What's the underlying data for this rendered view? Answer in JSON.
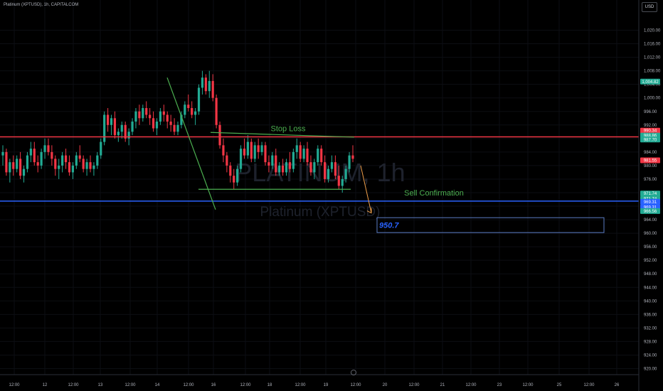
{
  "header": {
    "symbol_line": "Platinum (XPTUSD), 1h, CAPITALCOM",
    "currency": "USD"
  },
  "chart_data": {
    "type": "candlestick",
    "watermark": {
      "main": "PLATINUM, 1h",
      "sub": "Platinum (XPTUSD)"
    },
    "y_range": [
      918,
      1024
    ],
    "y_ticks": [
      "1,020.00",
      "1,016.00",
      "1,012.00",
      "1,008.00",
      "1,004.00",
      "1,000.00",
      "996.00",
      "992.00",
      "988.00",
      "984.00",
      "980.00",
      "976.00",
      "972.00",
      "968.00",
      "964.00",
      "960.00",
      "956.00",
      "952.00",
      "948.00",
      "944.00",
      "940.00",
      "936.00",
      "932.00",
      "928.00",
      "924.00",
      "920.00"
    ],
    "x_ticks": [
      "12:00",
      "12",
      "12:00",
      "13",
      "12:00",
      "14",
      "12:00",
      "16",
      "12:00",
      "18",
      "12:00",
      "19",
      "12:00",
      "20",
      "12:00",
      "21",
      "12:00",
      "23",
      "12:00",
      "25",
      "12:00",
      "26"
    ],
    "price_badges": [
      {
        "label": "1,004.82",
        "value": 1004.82,
        "color": "#22ab94"
      },
      {
        "label": "990.34",
        "value": 990.34,
        "color": "#f23645"
      },
      {
        "label": "990.34",
        "value": 990.34,
        "color": "#f23645",
        "offset": 1
      },
      {
        "label": "988.86",
        "value": 988.86,
        "color": "#22ab94"
      },
      {
        "label": "987.70",
        "value": 987.7,
        "color": "#22ab94"
      },
      {
        "label": "981.55",
        "value": 981.55,
        "color": "#f23645"
      },
      {
        "label": "971.74",
        "value": 971.74,
        "color": "#22ab94"
      },
      {
        "label": "971.74",
        "value": 971.74,
        "color": "#22ab94",
        "offset": 1
      },
      {
        "label": "969.31",
        "value": 969.31,
        "color": "#2962ff"
      },
      {
        "label": "969.31",
        "value": 969.31,
        "color": "#2962ff",
        "offset": 1
      },
      {
        "label": "966.56",
        "value": 966.56,
        "color": "#22ab94"
      }
    ],
    "annotations": {
      "stop_loss": {
        "label": "Stop Loss",
        "price": 988.5,
        "color": "#f23645"
      },
      "sell_confirmation": {
        "label": "Sell Confirmation",
        "price": 969.5,
        "color": "#2962ff"
      },
      "target": {
        "label": "950.7",
        "price": 950.7
      },
      "flag_top": {
        "from": 989.8,
        "to": 988.4,
        "color": "#4caf50"
      },
      "flag_bottom": {
        "price": 973.0,
        "color": "#4caf50"
      },
      "pole": {
        "from": 1006,
        "to": 967,
        "color": "#4caf50"
      },
      "arrow_color": "#f0a04b"
    },
    "candles_ohlc": [
      [
        983,
        986,
        980,
        984
      ],
      [
        984,
        985,
        977,
        978
      ],
      [
        978,
        982,
        975,
        981
      ],
      [
        981,
        983,
        977,
        979
      ],
      [
        979,
        983,
        978,
        982
      ],
      [
        982,
        984,
        976,
        977
      ],
      [
        977,
        980,
        975,
        979
      ],
      [
        979,
        984,
        978,
        983
      ],
      [
        983,
        987,
        981,
        985
      ],
      [
        985,
        987,
        980,
        981
      ],
      [
        981,
        983,
        978,
        980
      ],
      [
        980,
        985,
        979,
        984
      ],
      [
        984,
        988,
        982,
        986
      ],
      [
        986,
        988,
        983,
        984
      ],
      [
        984,
        986,
        980,
        982
      ],
      [
        982,
        983,
        977,
        979
      ],
      [
        979,
        982,
        976,
        980
      ],
      [
        980,
        984,
        978,
        983
      ],
      [
        983,
        985,
        979,
        981
      ],
      [
        981,
        983,
        977,
        978
      ],
      [
        978,
        981,
        976,
        980
      ],
      [
        980,
        984,
        979,
        983
      ],
      [
        983,
        986,
        981,
        982
      ],
      [
        982,
        983,
        978,
        979
      ],
      [
        979,
        982,
        977,
        981
      ],
      [
        981,
        983,
        978,
        979
      ],
      [
        979,
        981,
        977,
        980
      ],
      [
        980,
        984,
        979,
        983
      ],
      [
        983,
        988,
        982,
        987
      ],
      [
        987,
        996,
        986,
        995
      ],
      [
        995,
        997,
        990,
        992
      ],
      [
        992,
        995,
        989,
        994
      ],
      [
        994,
        996,
        988,
        989
      ],
      [
        989,
        991,
        987,
        990
      ],
      [
        990,
        993,
        988,
        992
      ],
      [
        992,
        993,
        987,
        988
      ],
      [
        988,
        991,
        986,
        990
      ],
      [
        990,
        994,
        989,
        993
      ],
      [
        993,
        997,
        991,
        996
      ],
      [
        996,
        998,
        992,
        994
      ],
      [
        994,
        998,
        993,
        997
      ],
      [
        997,
        999,
        994,
        995
      ],
      [
        995,
        997,
        992,
        994
      ],
      [
        994,
        996,
        990,
        991
      ],
      [
        991,
        994,
        989,
        993
      ],
      [
        993,
        997,
        992,
        996
      ],
      [
        996,
        998,
        993,
        995
      ],
      [
        995,
        996,
        991,
        993
      ],
      [
        993,
        995,
        990,
        992
      ],
      [
        992,
        994,
        989,
        990
      ],
      [
        990,
        993,
        989,
        992
      ],
      [
        992,
        996,
        991,
        995
      ],
      [
        995,
        999,
        994,
        998
      ],
      [
        998,
        1001,
        996,
        997
      ],
      [
        997,
        999,
        994,
        995
      ],
      [
        995,
        997,
        992,
        996
      ],
      [
        996,
        1004,
        995,
        1003
      ],
      [
        1003,
        1008,
        1001,
        1006
      ],
      [
        1006,
        1007,
        1001,
        1002
      ],
      [
        1002,
        1008,
        1000,
        1005
      ],
      [
        1005,
        1007,
        999,
        1000
      ],
      [
        1000,
        1001,
        991,
        992
      ],
      [
        992,
        993,
        985,
        986
      ],
      [
        986,
        988,
        981,
        983
      ],
      [
        983,
        984,
        978,
        980
      ],
      [
        980,
        981,
        975,
        977
      ],
      [
        977,
        979,
        973,
        975
      ],
      [
        975,
        980,
        974,
        979
      ],
      [
        979,
        986,
        978,
        985
      ],
      [
        985,
        988,
        982,
        983
      ],
      [
        983,
        989,
        982,
        987
      ],
      [
        987,
        988,
        981,
        982
      ],
      [
        982,
        987,
        981,
        986
      ],
      [
        986,
        988,
        982,
        984
      ],
      [
        984,
        987,
        983,
        986
      ],
      [
        986,
        987,
        980,
        981
      ],
      [
        981,
        983,
        978,
        980
      ],
      [
        980,
        984,
        979,
        983
      ],
      [
        983,
        985,
        977,
        978
      ],
      [
        978,
        981,
        977,
        980
      ],
      [
        980,
        982,
        977,
        978
      ],
      [
        978,
        982,
        977,
        981
      ],
      [
        981,
        984,
        978,
        979
      ],
      [
        979,
        985,
        978,
        984
      ],
      [
        984,
        988,
        982,
        986
      ],
      [
        986,
        987,
        981,
        982
      ],
      [
        982,
        986,
        981,
        985
      ],
      [
        985,
        987,
        980,
        981
      ],
      [
        981,
        983,
        977,
        978
      ],
      [
        978,
        982,
        976,
        981
      ],
      [
        981,
        986,
        980,
        985
      ],
      [
        985,
        986,
        980,
        981
      ],
      [
        981,
        983,
        975,
        976
      ],
      [
        976,
        980,
        975,
        979
      ],
      [
        979,
        983,
        978,
        981
      ],
      [
        981,
        983,
        976,
        977
      ],
      [
        977,
        980,
        973,
        974
      ],
      [
        974,
        977,
        972,
        976
      ],
      [
        976,
        980,
        975,
        979
      ],
      [
        979,
        984,
        978,
        983
      ],
      [
        983,
        986,
        981,
        982
      ]
    ]
  }
}
